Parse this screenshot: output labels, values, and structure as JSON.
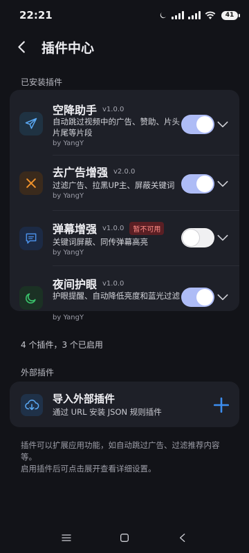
{
  "status_bar": {
    "time": "22:21",
    "battery": "41",
    "icons": [
      "moon-icon",
      "signal-icon",
      "signal-icon",
      "wifi-icon",
      "battery-icon"
    ]
  },
  "header": {
    "title": "插件中心",
    "back_icon": "chevron-left-icon"
  },
  "installed": {
    "section_label": "已安装插件",
    "plugins": [
      {
        "name": "空降助手",
        "version": "v1.0.0",
        "description": "自动跳过视频中的广告、赞助、片头片尾等片段",
        "author": "by YangY",
        "enabled": true,
        "icon": "paper-plane-icon",
        "icon_color": "#5aa8f2",
        "icon_bg": "#1f3242"
      },
      {
        "name": "去广告增强",
        "version": "v2.0.0",
        "description": "过滤广告、拉黑UP主、屏蔽关键词",
        "author": "by YangY",
        "enabled": true,
        "icon": "close-x-icon",
        "icon_color": "#f0922b",
        "icon_bg": "#3a2a1c"
      },
      {
        "name": "弹幕增强",
        "version": "v1.0.0",
        "badge": "暂不可用",
        "description": "关键词屏蔽、同传弹幕高亮",
        "author": "by YangY",
        "enabled": false,
        "icon": "chat-bubble-icon",
        "icon_color": "#4a8fe6",
        "icon_bg": "#1c2a44"
      },
      {
        "name": "夜间护眼",
        "version": "v1.0.0",
        "description": "护眼提醒、自动降低亮度和蓝光过滤",
        "author": "by YangY",
        "enabled": true,
        "icon": "crescent-moon-icon",
        "icon_color": "#39c06a",
        "icon_bg": "#1b3124"
      }
    ],
    "summary": "4 个插件，3 个已启用"
  },
  "external": {
    "section_label": "外部插件",
    "import_title": "导入外部插件",
    "import_subtitle": "通过 URL 安装 JSON 规则插件",
    "import_icon": "cloud-download-icon",
    "add_icon": "plus-icon",
    "accent": "#3d8ef0"
  },
  "footer": {
    "line1": "插件可以扩展应用功能，如自动跳过广告、过滤推荐内容等。",
    "line2": "启用插件后可点击展开查看详细设置。"
  },
  "nav": {
    "icons": [
      "menu-icon",
      "home-square-icon",
      "back-triangle-icon"
    ]
  }
}
